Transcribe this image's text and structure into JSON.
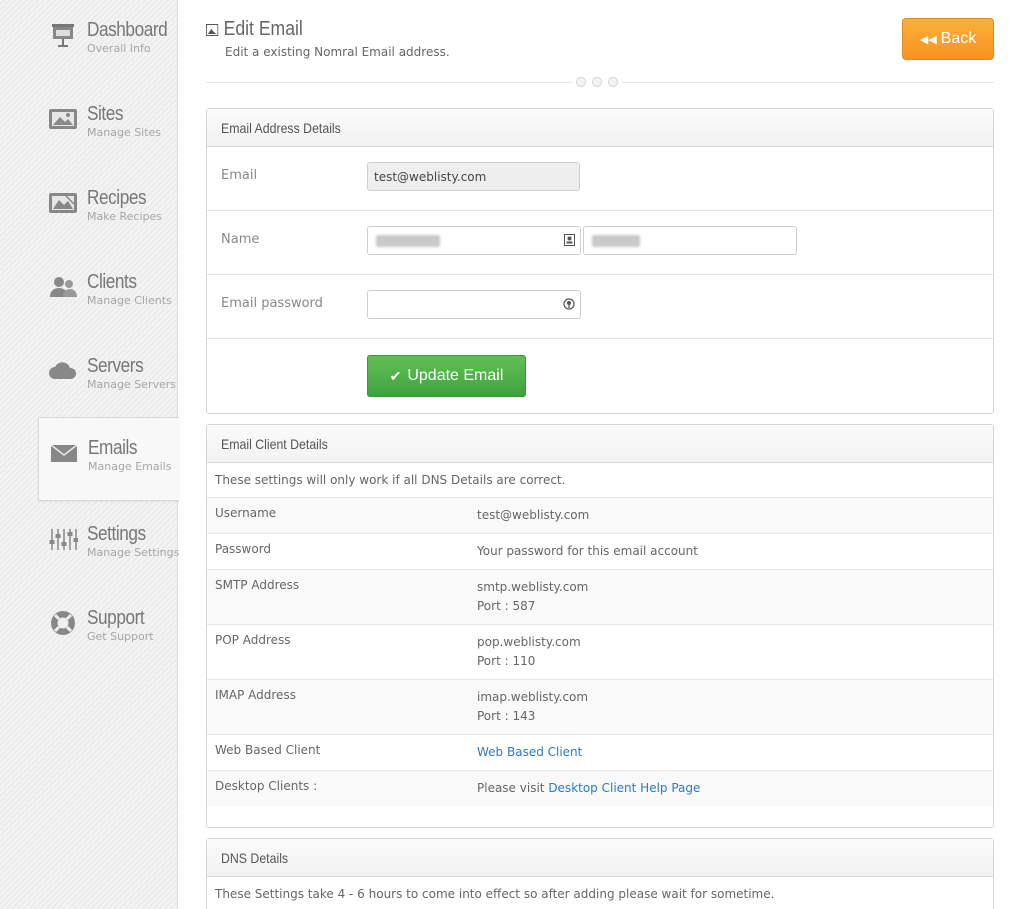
{
  "sidebar": {
    "items": [
      {
        "title": "Dashboard",
        "sub": "Overall Info",
        "icon": "presentation-icon"
      },
      {
        "title": "Sites",
        "sub": "Manage Sites",
        "icon": "image-icon"
      },
      {
        "title": "Recipes",
        "sub": "Make Recipes",
        "icon": "recipe-image-icon"
      },
      {
        "title": "Clients",
        "sub": "Manage Clients",
        "icon": "users-icon"
      },
      {
        "title": "Servers",
        "sub": "Manage Servers",
        "icon": "cloud-icon"
      },
      {
        "title": "Emails",
        "sub": "Manage Emails",
        "icon": "envelope-icon",
        "active": true
      },
      {
        "title": "Settings",
        "sub": "Manage Settings",
        "icon": "sliders-icon"
      },
      {
        "title": "Support",
        "sub": "Get Support",
        "icon": "lifebuoy-icon"
      }
    ]
  },
  "header": {
    "title": "Edit Email",
    "subtitle": "Edit a existing Nomral Email address.",
    "back_label": "Back"
  },
  "email_details": {
    "heading": "Email Address Details",
    "email_label": "Email",
    "email_value": "test@weblisty.com",
    "name_label": "Name",
    "password_label": "Email password",
    "update_label": "Update Email"
  },
  "client_details": {
    "heading": "Email Client Details",
    "note": "These settings will only work if all DNS Details are correct.",
    "rows": [
      {
        "key": "Username",
        "value": "test@weblisty.com",
        "port": ""
      },
      {
        "key": "Password",
        "value": "Your password for this email account",
        "port": ""
      },
      {
        "key": "SMTP Address",
        "value": "smtp.weblisty.com",
        "port": "Port : 587"
      },
      {
        "key": "POP Address",
        "value": "pop.weblisty.com",
        "port": "Port : 110"
      },
      {
        "key": "IMAP Address",
        "value": "imap.weblisty.com",
        "port": "Port : 143"
      }
    ],
    "web_client_key": "Web Based Client",
    "web_client_link": "Web Based Client",
    "desktop_key": "Desktop Clients :",
    "desktop_prefix": "Please visit",
    "desktop_link": "Desktop Client Help Page"
  },
  "dns_details": {
    "heading": "DNS Details",
    "note": "These Settings take 4 - 6 hours to come into effect so after adding please wait for sometime."
  },
  "colors": {
    "back_button": "#f7931e",
    "update_button": "#4caf4a",
    "link": "#2a7cc4"
  }
}
